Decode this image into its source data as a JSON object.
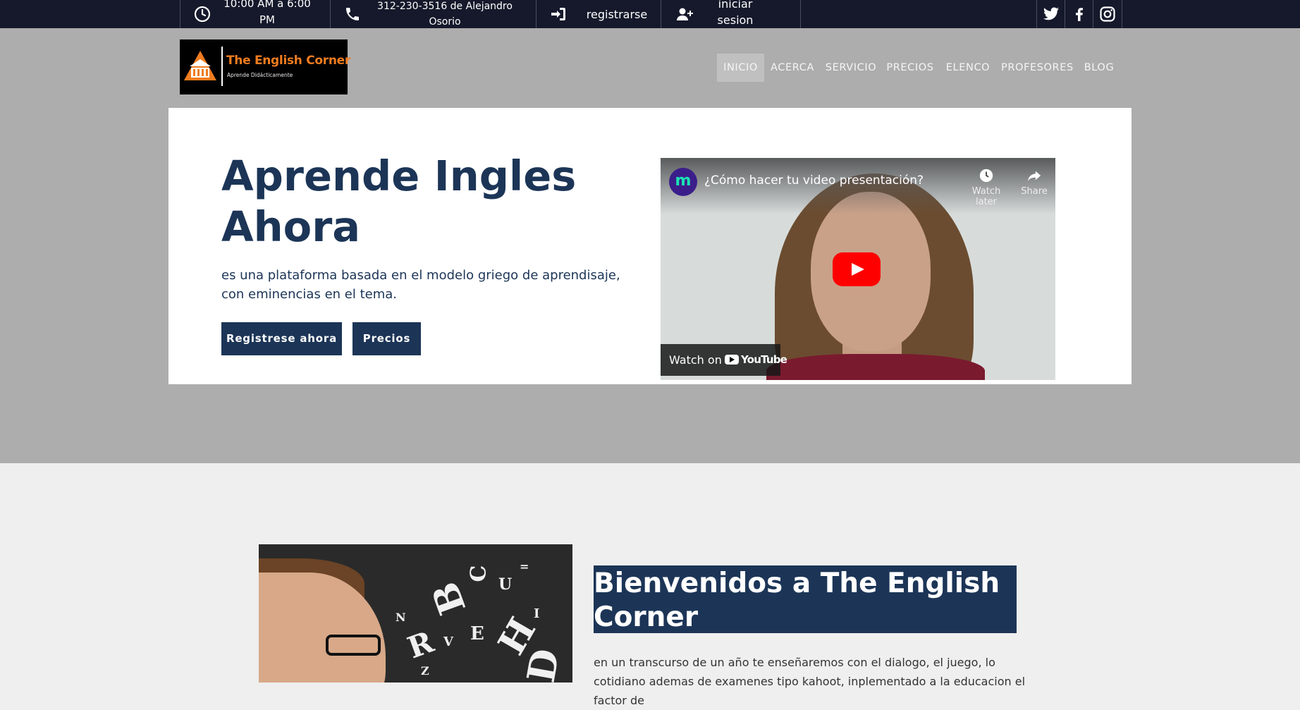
{
  "topbar": {
    "hours": "10:00 AM a 6:00 PM",
    "phone": "312-230-3516 de Alejandro Osorio",
    "register": "registrarse",
    "login": "iniciar sesion",
    "social": [
      "twitter-icon",
      "facebook-icon",
      "instagram-icon"
    ]
  },
  "header": {
    "logo_title": "The English Corner",
    "logo_subtitle": "Aprende Didácticamente",
    "nav": [
      "INICIO",
      "ACERCA",
      "SERVICIO",
      "PRECIOS",
      "ELENCO",
      "PROFESORES",
      "BLOG"
    ],
    "active_nav": "INICIO"
  },
  "hero": {
    "title": "Aprende Ingles Ahora",
    "description": "es una plataforma basada en el modelo griego de aprendisaje, con eminencias en el tema.",
    "primary_button": "Registrese ahora",
    "secondary_button": "Precios"
  },
  "video": {
    "title": "¿Cómo hacer tu video presentación?",
    "channel_initial": "m",
    "watch_later": "Watch later",
    "share": "Share",
    "watch_on": "Watch on",
    "youtube": "YouTube"
  },
  "welcome": {
    "heading": "Bienvenidos a The English Corner",
    "body": "en un transcurso de un año te enseñaremos con el dialogo, el juego, lo cotidiano ademas de examenes tipo kahoot, inplementado a la educacion el factor de"
  },
  "colors": {
    "topbar": "#15192b",
    "header": "#adadad",
    "brand_navy": "#1c3557",
    "brand_orange": "#f07c1f"
  }
}
